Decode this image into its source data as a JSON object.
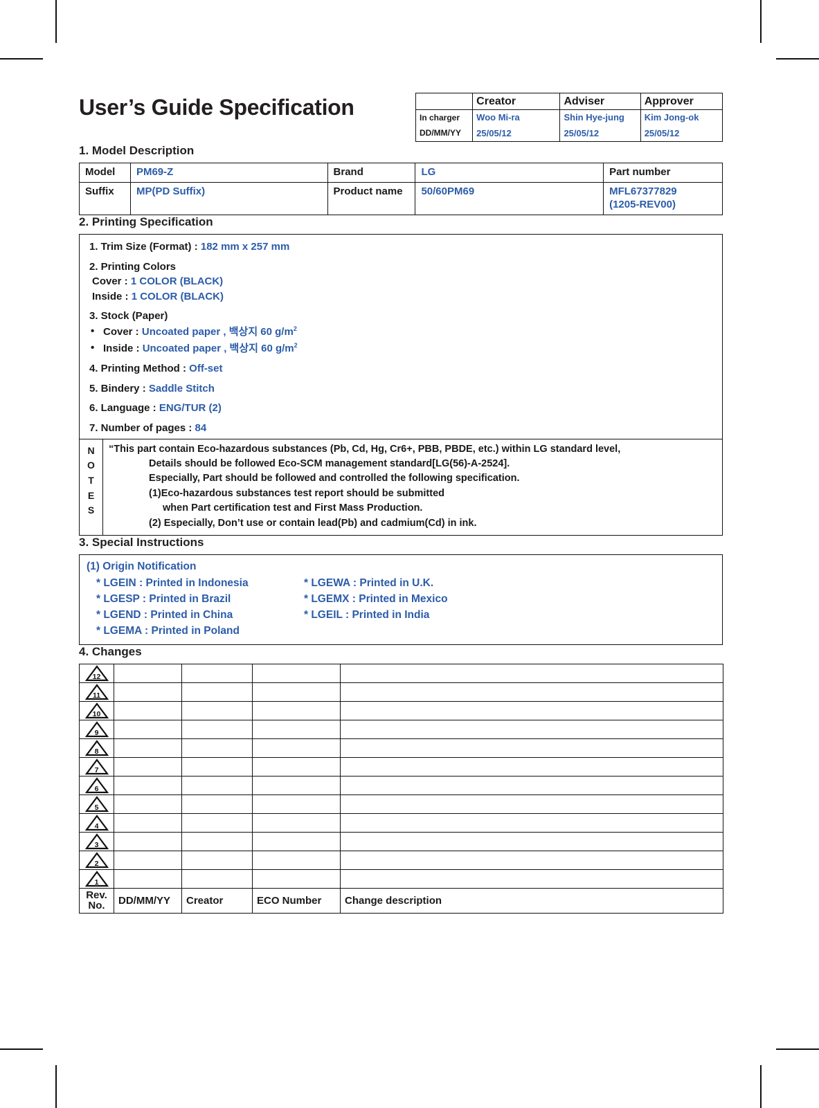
{
  "document": {
    "title": "User’s Guide Specification"
  },
  "accent_color": "#2c5ca8",
  "signature_table": {
    "corner_label": "",
    "headers": [
      "Creator",
      "Adviser",
      "Approver"
    ],
    "rows": [
      {
        "label": "In charger",
        "values": [
          "Woo Mi-ra",
          "Shin Hye-jung",
          "Kim Jong-ok"
        ]
      },
      {
        "label": "DD/MM/YY",
        "values": [
          "25/05/12",
          "25/05/12",
          "25/05/12"
        ]
      }
    ]
  },
  "section1": {
    "heading": "1. Model Description",
    "row1": {
      "k1": "Model",
      "v1": "PM69-Z",
      "k2": "Brand",
      "v2": "LG",
      "v3": "Part number"
    },
    "row2": {
      "k1": "Suffix",
      "v1": "MP(PD Suffix)",
      "k2": "Product name",
      "v2": "50/60PM69",
      "v3_line1": "MFL67377829",
      "v3_line2": "(1205-REV00)"
    }
  },
  "section2": {
    "heading": "2. Printing Specification",
    "trim_label": "1. Trim Size (Format) : ",
    "trim_value": "182 mm x 257 mm",
    "colors_label": "2. Printing Colors",
    "colors_cover_label": "Cover : ",
    "colors_cover_value": "1 COLOR (BLACK)",
    "colors_inside_label": "Inside : ",
    "colors_inside_value": "1 COLOR (BLACK)",
    "stock_label": "3. Stock (Paper)",
    "stock_cover_label": "Cover : ",
    "stock_cover_value": "Uncoated paper , 백상지 60 g/m",
    "stock_cover_sup": "2",
    "stock_inside_label": "Inside : ",
    "stock_inside_value": "Uncoated paper , 백상지 60 g/m",
    "stock_inside_sup": "2",
    "method_label": "4. Printing Method : ",
    "method_value": "Off-set",
    "bindery_label": "5. Bindery  : ",
    "bindery_value": "Saddle Stitch",
    "language_label": "6. Language : ",
    "language_value": "ENG/TUR (2)",
    "pages_label": "7. Number of pages : ",
    "pages_value": "84"
  },
  "notes": {
    "label": "NOTES",
    "lines": [
      "“This part contain Eco-hazardous substances (Pb, Cd, Hg, Cr6+, PBB, PBDE, etc.) within LG standard level,",
      "Details should be followed Eco-SCM management standard[LG(56)-A-2524].",
      "Especially, Part should be followed and controlled the following specification.",
      "(1)Eco-hazardous substances test report should be submitted",
      "when  Part certification test and First Mass Production.",
      "(2) Especially, Don’t use or contain lead(Pb) and cadmium(Cd) in ink."
    ]
  },
  "section3": {
    "heading": "3. Special Instructions",
    "origin_heading": "(1) Origin Notification",
    "origin_rows": [
      {
        "left": "* LGEIN : Printed in Indonesia",
        "right": "* LGEWA : Printed in U.K."
      },
      {
        "left": "* LGESP : Printed in Brazil",
        "right": "* LGEMX : Printed in Mexico"
      },
      {
        "left": "* LGEND : Printed in China",
        "right": "* LGEIL : Printed in India"
      },
      {
        "left": "* LGEMA : Printed in Poland",
        "right": ""
      }
    ]
  },
  "section4": {
    "heading": "4. Changes",
    "rev_numbers": [
      "12",
      "11",
      "10",
      "9",
      "8",
      "7",
      "6",
      "5",
      "4",
      "3",
      "2",
      "1"
    ],
    "footer_headers": {
      "rev": "Rev.",
      "rev2": "No.",
      "date": "DD/MM/YY",
      "creator": "Creator",
      "eco": "ECO Number",
      "description": "Change description"
    },
    "empty_cell": ""
  }
}
